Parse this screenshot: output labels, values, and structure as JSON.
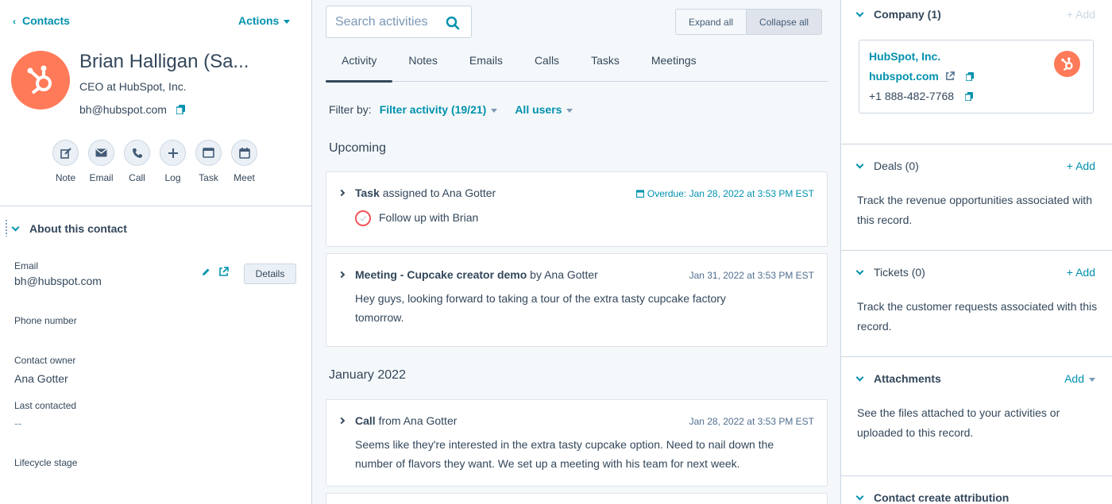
{
  "header": {
    "back_label": "Contacts",
    "actions_label": "Actions"
  },
  "contact": {
    "name": "Brian Halligan (Sa...",
    "title": "CEO at HubSpot, Inc.",
    "email": "bh@hubspot.com"
  },
  "quick_actions": [
    {
      "label": "Note",
      "icon": "note-icon"
    },
    {
      "label": "Email",
      "icon": "email-icon"
    },
    {
      "label": "Call",
      "icon": "phone-icon"
    },
    {
      "label": "Log",
      "icon": "plus-icon"
    },
    {
      "label": "Task",
      "icon": "task-icon"
    },
    {
      "label": "Meet",
      "icon": "calendar-icon"
    }
  ],
  "about": {
    "header": "About this contact",
    "details_button": "Details",
    "properties": [
      {
        "label": "Email",
        "value": "bh@hubspot.com"
      },
      {
        "label": "Phone number",
        "value": ""
      },
      {
        "label": "Contact owner",
        "value": "Ana Gotter"
      },
      {
        "label": "Last contacted",
        "value": "--"
      },
      {
        "label": "Lifecycle stage",
        "value": ""
      }
    ]
  },
  "timeline": {
    "search_placeholder": "Search activities",
    "expand_all": "Expand all",
    "collapse_all": "Collapse all",
    "tabs": [
      "Activity",
      "Notes",
      "Emails",
      "Calls",
      "Tasks",
      "Meetings"
    ],
    "active_tab": "Activity",
    "filter_by_label": "Filter by:",
    "filter_activity": "Filter activity (19/21)",
    "all_users": "All users",
    "upcoming_title": "Upcoming",
    "month_title": "January 2022",
    "cards": [
      {
        "type": "Task",
        "suffix": "assigned to Ana Gotter",
        "date": "Overdue: Jan 28, 2022 at 3:53 PM EST",
        "body": "Follow up with Brian"
      },
      {
        "type": "Meeting - Cupcake creator demo",
        "suffix": "by Ana Gotter",
        "date": "Jan 31, 2022 at 3:53 PM EST",
        "body": "Hey guys, looking forward to taking a tour of the extra tasty cupcake factory tomorrow."
      },
      {
        "type": "Call",
        "suffix": "from Ana Gotter",
        "date": "Jan 28, 2022 at 3:53 PM EST",
        "body": "Seems like they're interested in the extra tasty cupcake option. Need to nail down the number of flavors they want. We set up a meeting with his team for next week."
      }
    ]
  },
  "sidebar": {
    "company": {
      "header": "Company (1)",
      "add": "+ Add",
      "name": "HubSpot, Inc.",
      "domain": "hubspot.com",
      "phone": "+1 888-482-7768"
    },
    "deals": {
      "header": "Deals (0)",
      "add": "+ Add",
      "text": "Track the revenue opportunities associated with this record."
    },
    "tickets": {
      "header": "Tickets (0)",
      "add": "+ Add",
      "text": "Track the customer requests associated with this record."
    },
    "attachments": {
      "header": "Attachments",
      "add": "Add",
      "text": "See the files attached to your activities or uploaded to this record."
    },
    "attribution": {
      "header": "Contact create attribution"
    }
  },
  "colors": {
    "accent": "#0091ae",
    "brand_orange": "#ff7a59",
    "text": "#33475b",
    "overdue_circle": "#f2545b"
  }
}
